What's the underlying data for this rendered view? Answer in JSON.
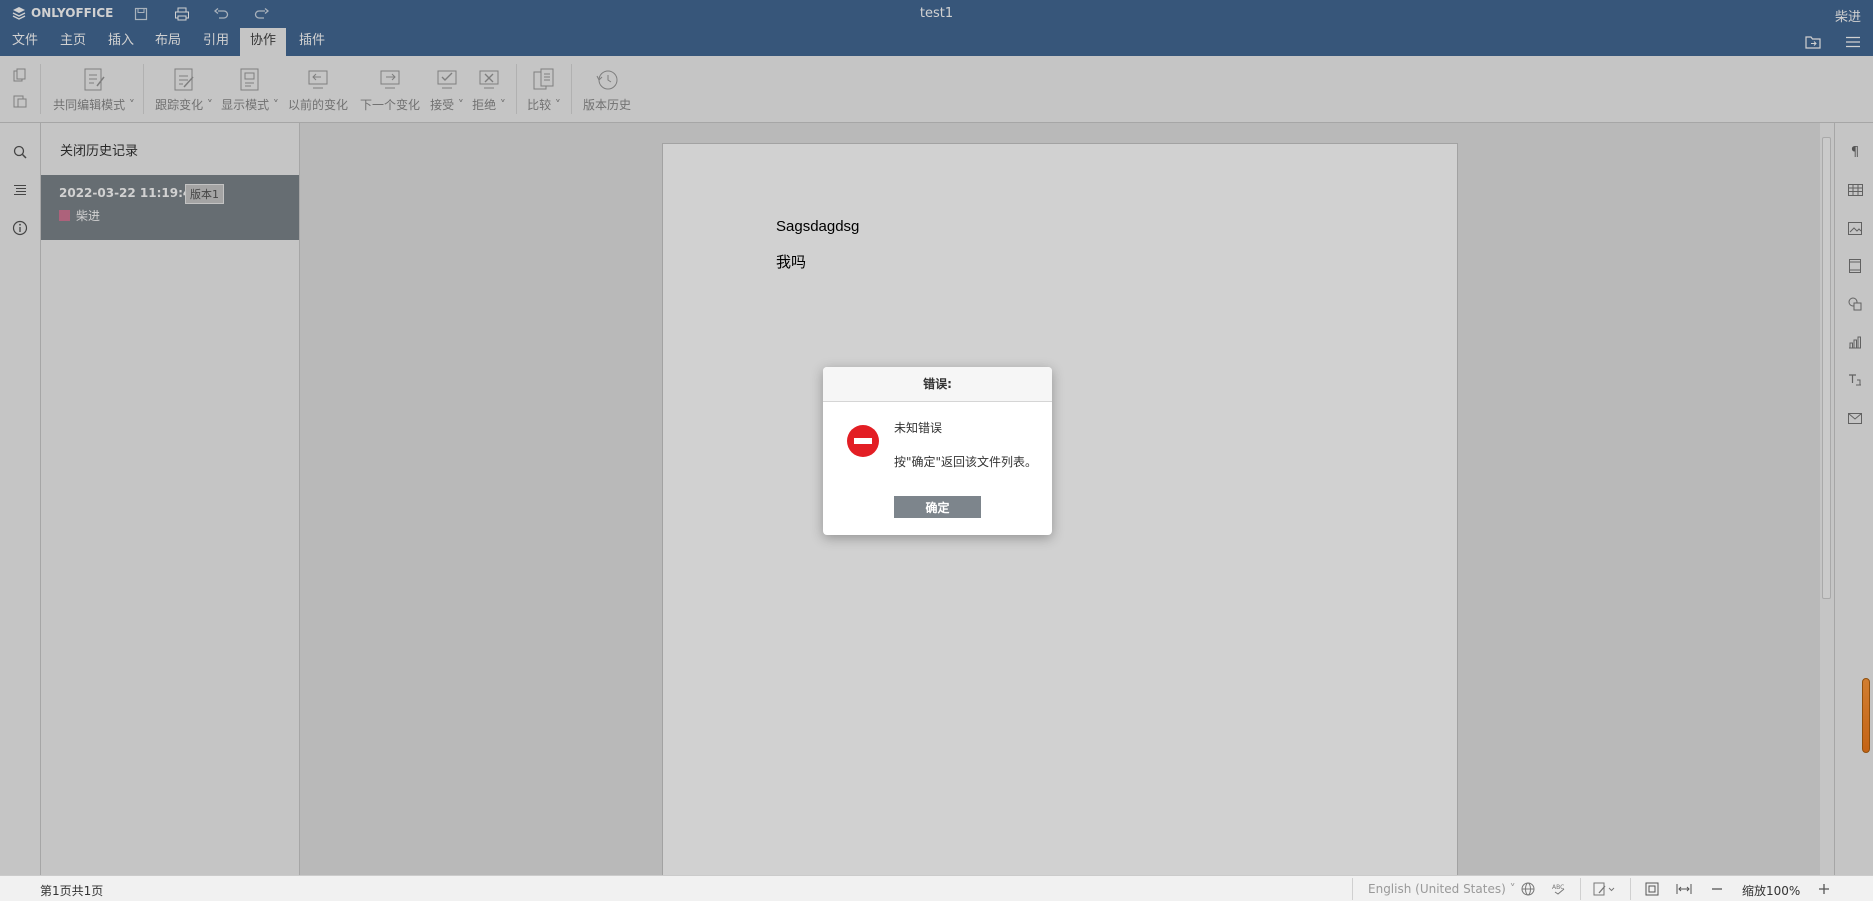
{
  "header": {
    "brand": "ONLYOFFICE",
    "doc_title": "test1",
    "user": "柴进"
  },
  "tabs": [
    {
      "label": "文件"
    },
    {
      "label": "主页"
    },
    {
      "label": "插入"
    },
    {
      "label": "布局"
    },
    {
      "label": "引用"
    },
    {
      "label": "协作",
      "active": true
    },
    {
      "label": "插件"
    }
  ],
  "toolbar": {
    "co_edit": "共同编辑模式",
    "track_changes": "跟踪变化",
    "display_mode": "显示模式",
    "prev_change": "以前的变化",
    "next_change": "下一个变化",
    "accept": "接受",
    "reject": "拒绝",
    "compare": "比较",
    "version_history": "版本历史"
  },
  "history": {
    "close_label": "关闭历史记录",
    "versions": [
      {
        "date": "2022-03-22 11:19:43",
        "badge": "版本1",
        "user": "柴进",
        "user_color": "#d47896"
      }
    ]
  },
  "document": {
    "lines": [
      "Sagsdagdsg",
      "我吗"
    ]
  },
  "dialog": {
    "title": "错误:",
    "message": "未知错误",
    "hint": "按\"确定\"返回该文件列表。",
    "ok_label": "确定"
  },
  "status": {
    "page_info": "第1页共1页",
    "language": "English (United States)",
    "zoom": "缩放100%"
  },
  "colors": {
    "header_bg": "#446995",
    "error_red": "#e31e24",
    "selected_version_bg": "#7d858c"
  }
}
